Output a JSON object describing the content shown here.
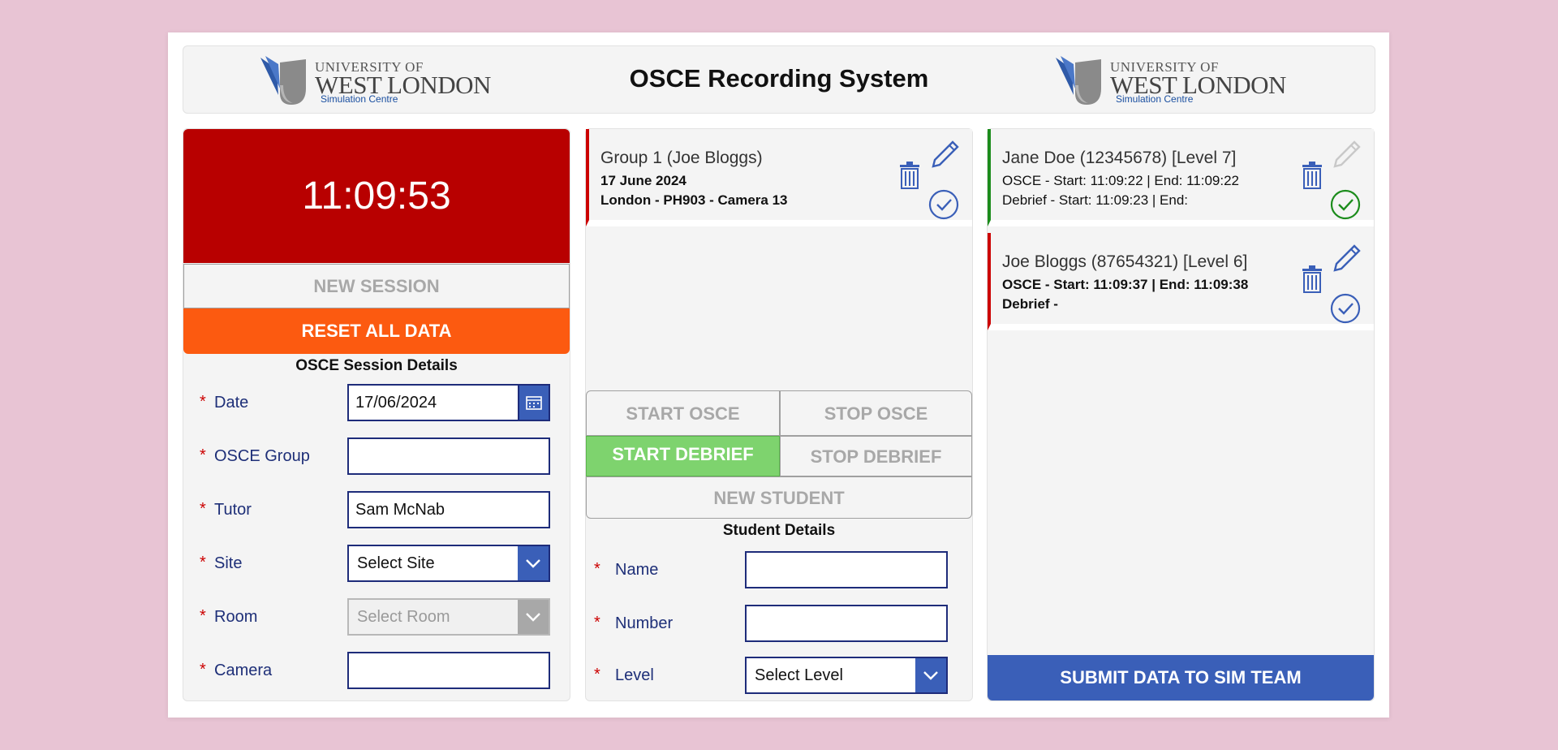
{
  "header": {
    "title": "OSCE Recording System",
    "logo": {
      "line1": "UNIVERSITY OF",
      "line2": "WEST LONDON",
      "line3": "Simulation Centre"
    }
  },
  "left": {
    "clock": "11:09:53",
    "new_session_label": "NEW SESSION",
    "reset_label": "RESET ALL DATA",
    "section_title": "OSCE Session Details",
    "fields": {
      "date": {
        "label": "Date",
        "value": "17/06/2024"
      },
      "group": {
        "label": "OSCE Group",
        "value": ""
      },
      "tutor": {
        "label": "Tutor",
        "value": "Sam McNab"
      },
      "site": {
        "label": "Site",
        "value": "Select Site"
      },
      "room": {
        "label": "Room",
        "value": "Select Room"
      },
      "camera": {
        "label": "Camera",
        "value": ""
      }
    },
    "required_mark": "*"
  },
  "middle": {
    "group_card": {
      "title": "Group 1 (Joe Bloggs)",
      "date": "17 June 2024",
      "location": "London - PH903 - Camera 13"
    },
    "controls": {
      "start_osce": "START OSCE",
      "stop_osce": "STOP OSCE",
      "start_debrief": "START DEBRIEF",
      "stop_debrief": "STOP DEBRIEF",
      "new_student": "NEW STUDENT"
    },
    "section_title": "Student Details",
    "fields": {
      "name": {
        "label": "Name",
        "value": ""
      },
      "number": {
        "label": "Number",
        "value": ""
      },
      "level": {
        "label": "Level",
        "value": "Select Level"
      }
    }
  },
  "right": {
    "students": [
      {
        "title": "Jane Doe (12345678) [Level 7]",
        "osce": "OSCE - Start: 11:09:22 | End: 11:09:22",
        "debrief": "Debrief - Start: 11:09:23 | End:",
        "status_color": "#1c8c1c"
      },
      {
        "title": "Joe Bloggs (87654321) [Level 6]",
        "osce": "OSCE - Start: 11:09:37 | End: 11:09:38",
        "debrief": "Debrief -",
        "status_color": "#cc0000"
      }
    ],
    "submit_label": "SUBMIT DATA TO SIM TEAM"
  },
  "colors": {
    "background": "#e8c4d4",
    "clock": "#b80000",
    "reset": "#fc5a10",
    "accent": "#3a5fb8",
    "active_green": "#7ed36e"
  }
}
